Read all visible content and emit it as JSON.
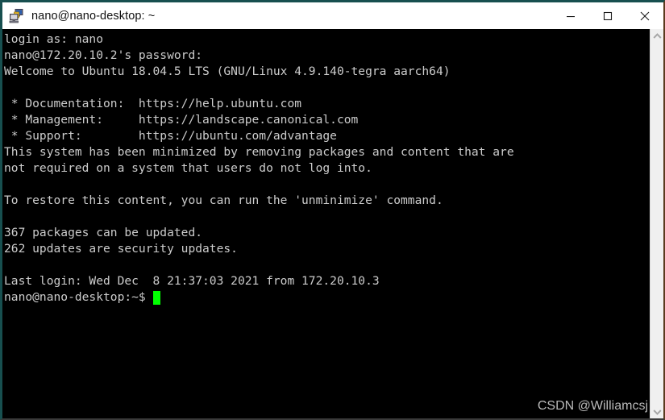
{
  "window": {
    "title": "nano@nano-desktop: ~",
    "icon": "putty-terminal-icon",
    "controls": {
      "minimize_label": "Minimize",
      "maximize_label": "Maximize",
      "close_label": "Close"
    }
  },
  "terminal": {
    "background": "#000000",
    "foreground": "#cccccc",
    "cursor_color": "#00ff00",
    "lines": [
      "login as: nano",
      "nano@172.20.10.2's password:",
      "Welcome to Ubuntu 18.04.5 LTS (GNU/Linux 4.9.140-tegra aarch64)",
      "",
      " * Documentation:  https://help.ubuntu.com",
      " * Management:     https://landscape.canonical.com",
      " * Support:        https://ubuntu.com/advantage",
      "This system has been minimized by removing packages and content that are",
      "not required on a system that users do not log into.",
      "",
      "To restore this content, you can run the 'unminimize' command.",
      "",
      "367 packages can be updated.",
      "262 updates are security updates.",
      "",
      "Last login: Wed Dec  8 21:37:03 2021 from 172.20.10.3"
    ],
    "prompt": "nano@nano-desktop:~$"
  },
  "watermark": {
    "text": "CSDN @Williamcsj"
  },
  "scrollbar": {
    "up_arrow": "chevron-up-icon",
    "down_arrow": "chevron-down-icon"
  }
}
